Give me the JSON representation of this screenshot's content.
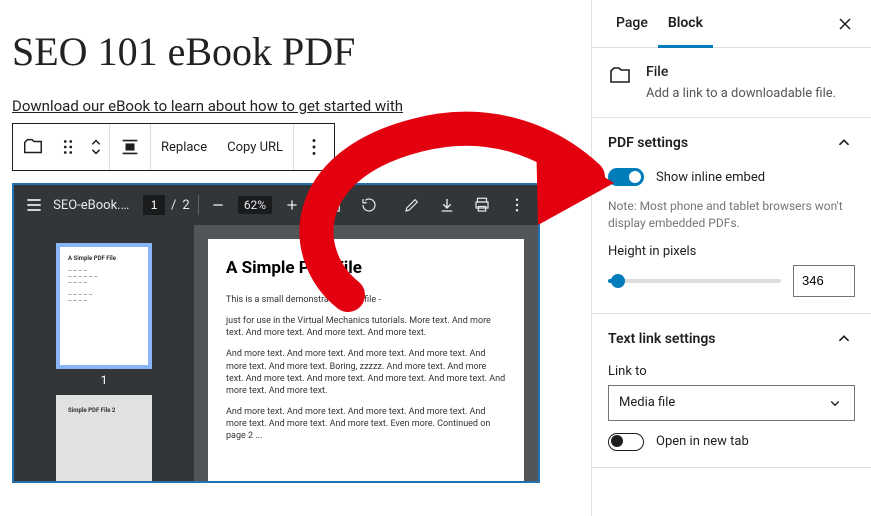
{
  "page": {
    "title": "SEO 101 eBook PDF",
    "intro": "Download our eBook to learn about how to get started with"
  },
  "toolbar": {
    "replace": "Replace",
    "copy_url": "Copy URL"
  },
  "pdf": {
    "filename": "SEO-eBook.p...",
    "current_page": "1",
    "total_pages": "2",
    "zoom": "62%",
    "thumb1_label": "1",
    "thumb1_title": "A Simple PDF File",
    "thumb2_title": "Simple PDF File 2",
    "doc_title": "A Simple PDF File",
    "p1": "This is a small demonstration .pdf file -",
    "p2": "just for use in the Virtual Mechanics tutorials. More text. And more text. And more text. And more text. And more text.",
    "p3": "And more text. And more text. And more text. And more text. And more text. And more text. Boring, zzzzz. And more text. And more text. And more text. And more text. And more text. And more text. And more text. And more text.",
    "p4": "And more text. And more text. And more text. And more text. And more text. And more text. And more text. Even more. Continued on page 2 ..."
  },
  "sidebar": {
    "tabs": {
      "page": "Page",
      "block": "Block"
    },
    "block": {
      "name": "File",
      "desc": "Add a link to a downloadable file."
    },
    "pdf_settings": {
      "title": "PDF settings",
      "show_inline": "Show inline embed",
      "note": "Note: Most phone and tablet browsers won't display embedded PDFs.",
      "height_label": "Height in pixels",
      "height_value": "346"
    },
    "text_link": {
      "title": "Text link settings",
      "link_to_label": "Link to",
      "link_to_value": "Media file",
      "open_new_tab": "Open in new tab"
    }
  }
}
